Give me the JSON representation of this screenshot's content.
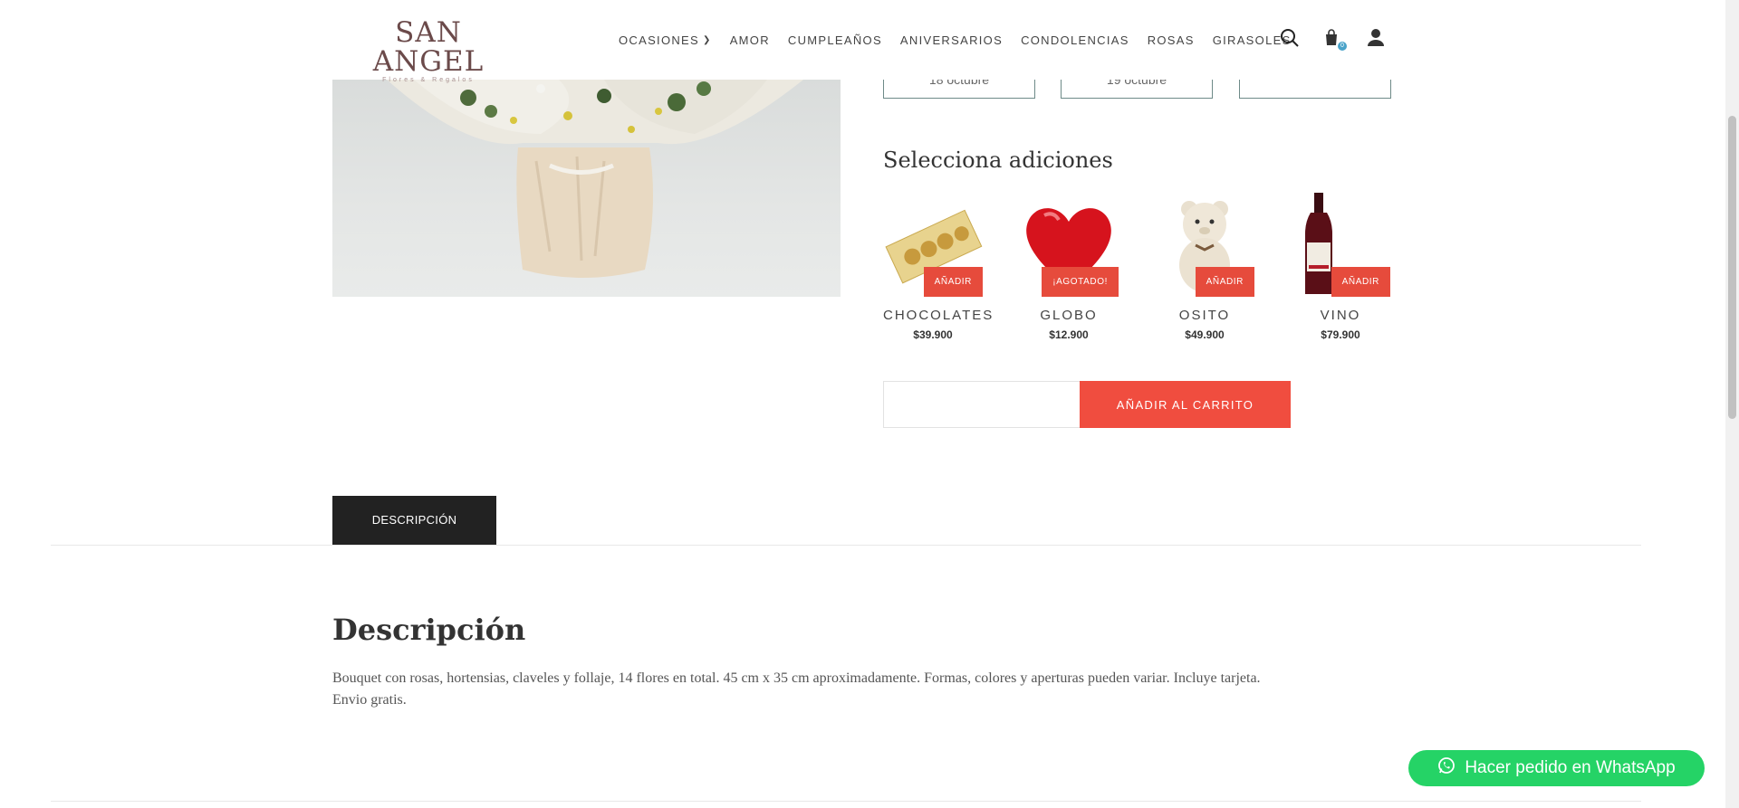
{
  "header": {
    "logo_main": "SAN ANGEL",
    "logo_sub": "Flores & Regalos",
    "nav": [
      "OCASIONES",
      "AMOR",
      "CUMPLEAÑOS",
      "ANIVERSARIOS",
      "CONDOLENCIAS",
      "ROSAS",
      "GIRASOLES"
    ],
    "cart_count": "0"
  },
  "dates": [
    "18 octubre",
    "19 octubre",
    ""
  ],
  "addons": {
    "title": "Selecciona adiciones",
    "items": [
      {
        "name": "CHOCOLATES",
        "price": "$39.900",
        "button": "AÑADIR"
      },
      {
        "name": "GLOBO",
        "price": "$12.900",
        "button": "¡AGOTADO!"
      },
      {
        "name": "OSITO",
        "price": "$49.900",
        "button": "AÑADIR"
      },
      {
        "name": "VINO",
        "price": "$79.900",
        "button": "AÑADIR"
      }
    ]
  },
  "cart": {
    "qty_value": "",
    "button_label": "AÑADIR AL CARRITO"
  },
  "tabs": {
    "description_label": "DESCRIPCIÓN"
  },
  "description": {
    "title": "Descripción",
    "text_line1": "Bouquet con rosas, hortensias, claveles y follaje, 14 flores en total. 45  cm x 35 cm aproximadamente. Formas, colores y aperturas pueden variar. Incluye tarjeta.",
    "text_line2": "Envio gratis."
  },
  "whatsapp": {
    "label": "Hacer pedido en WhatsApp"
  },
  "colors": {
    "accent": "#f04d3f",
    "whatsapp": "#25d366",
    "dark_tab": "#222222"
  }
}
